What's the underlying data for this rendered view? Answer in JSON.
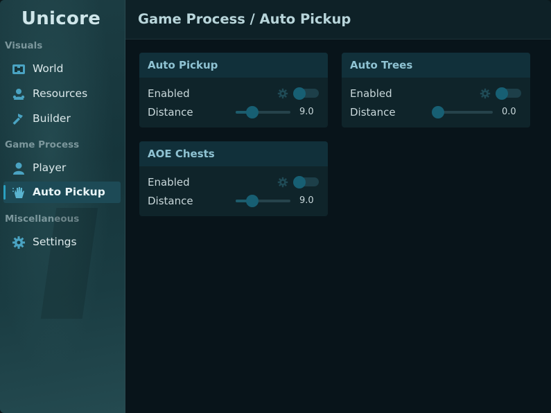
{
  "brand": "Unicore",
  "sidebar": {
    "sections": [
      {
        "label": "Visuals",
        "items": [
          {
            "label": "World",
            "icon": "map-icon"
          },
          {
            "label": "Resources",
            "icon": "resources-icon"
          },
          {
            "label": "Builder",
            "icon": "hammer-icon"
          }
        ]
      },
      {
        "label": "Game Process",
        "items": [
          {
            "label": "Player",
            "icon": "person-icon"
          },
          {
            "label": "Auto Pickup",
            "icon": "hand-icon",
            "active": true
          }
        ]
      },
      {
        "label": "Miscellaneous",
        "items": [
          {
            "label": "Settings",
            "icon": "gear-icon"
          }
        ]
      }
    ]
  },
  "header": {
    "title": "Game Process / Auto Pickup"
  },
  "cards": [
    {
      "title": "Auto Pickup",
      "enabled_label": "Enabled",
      "enabled": false,
      "distance_label": "Distance",
      "distance": "9.0",
      "distance_fraction": 0.31
    },
    {
      "title": "Auto Trees",
      "enabled_label": "Enabled",
      "enabled": false,
      "distance_label": "Distance",
      "distance": "0.0",
      "distance_fraction": 0.0
    },
    {
      "title": "AOE Chests",
      "enabled_label": "Enabled",
      "enabled": false,
      "distance_label": "Distance",
      "distance": "9.0",
      "distance_fraction": 0.31
    }
  ],
  "colors": {
    "accent": "#2aa0c0",
    "toggle_knob": "#175f73",
    "card_header_text": "#8fc3d3"
  }
}
